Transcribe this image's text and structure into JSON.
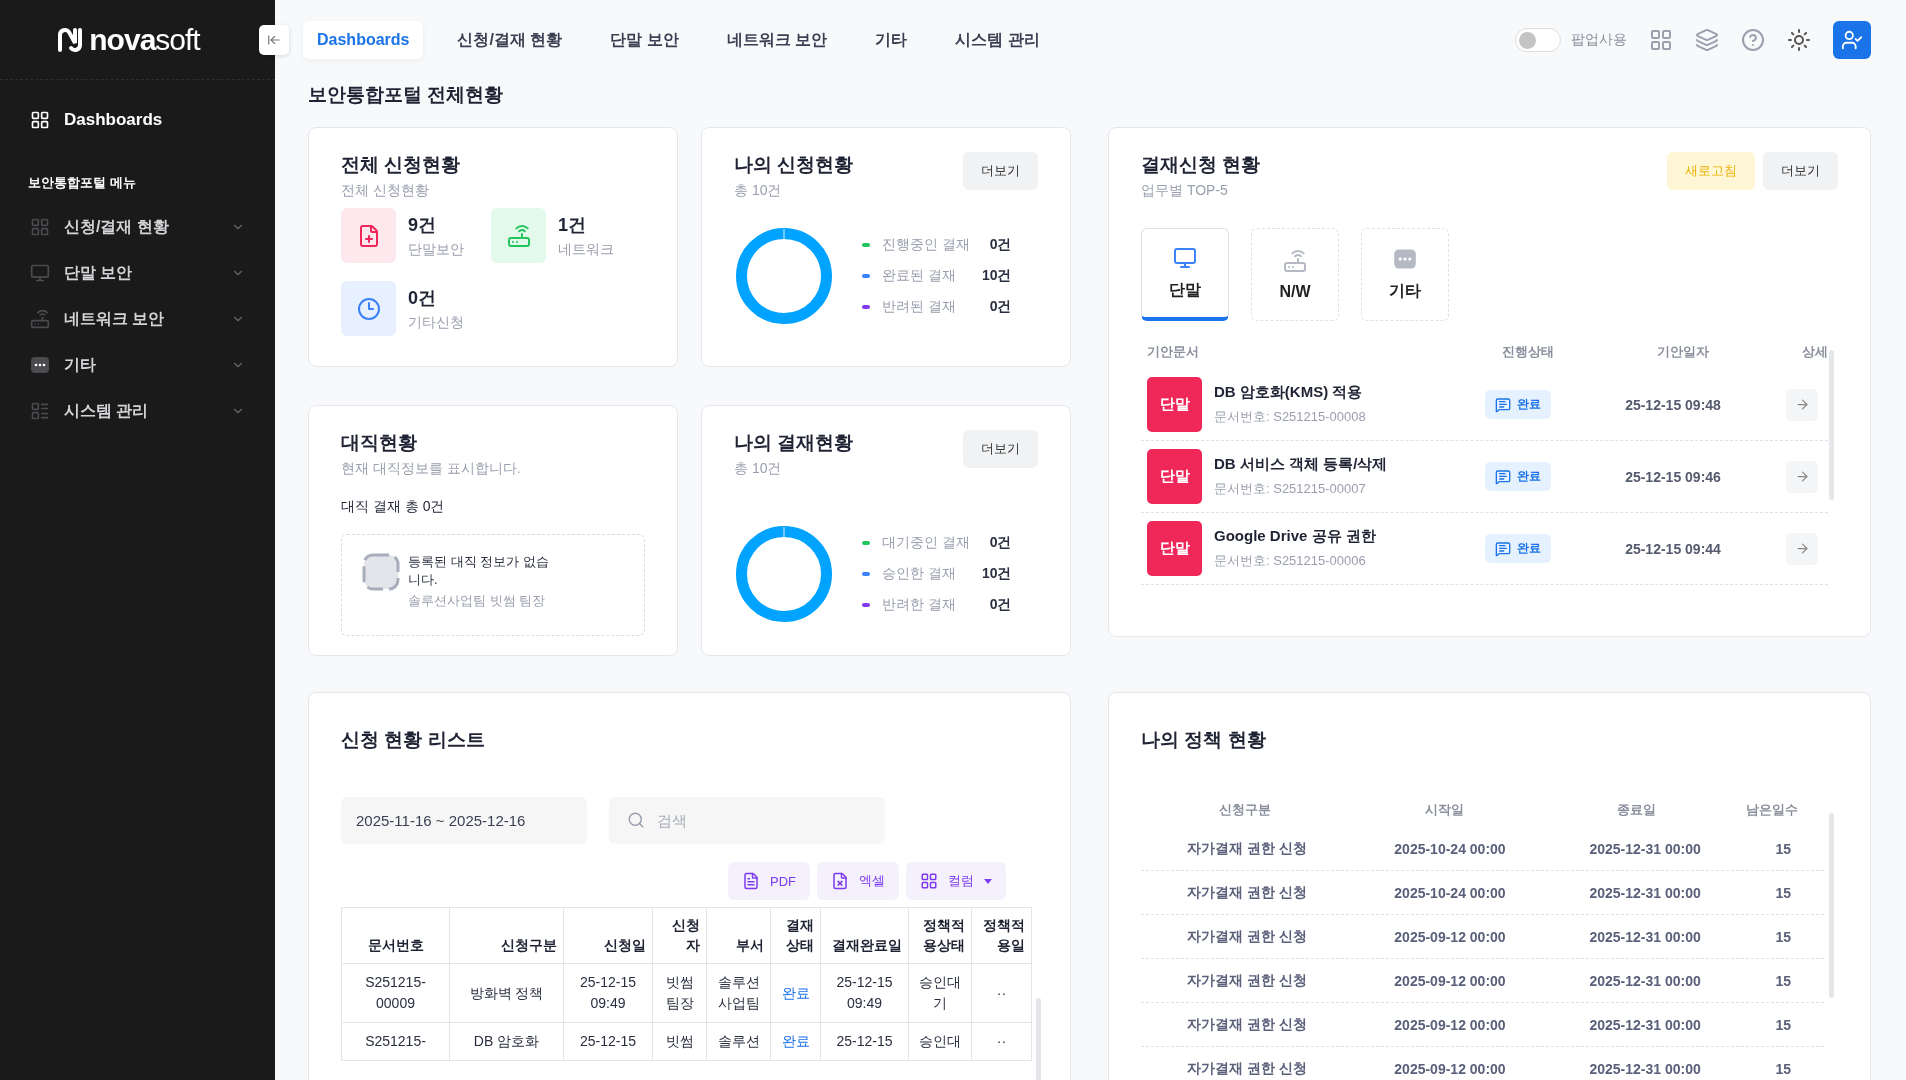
{
  "logo": {
    "strong": "nova",
    "light": "soft"
  },
  "top_nav": [
    {
      "label": "Dashboards",
      "selected": true
    },
    {
      "label": "신청/결재 현황",
      "selected": false
    },
    {
      "label": "단말 보안",
      "selected": false
    },
    {
      "label": "네트워크 보안",
      "selected": false
    },
    {
      "label": "기타",
      "selected": false
    },
    {
      "label": "시스템 관리",
      "selected": false
    }
  ],
  "popup_toggle": {
    "label": "팝업사용",
    "on": false
  },
  "sidebar": {
    "home": {
      "label": "Dashboards"
    },
    "section_title": "보안통합포털 메뉴",
    "items": [
      {
        "kind": "approval",
        "label": "신청/결재 현황"
      },
      {
        "kind": "terminal",
        "label": "단말 보안"
      },
      {
        "kind": "network",
        "label": "네트워크 보안"
      },
      {
        "kind": "other",
        "label": "기타"
      },
      {
        "kind": "system",
        "label": "시스템 관리"
      }
    ]
  },
  "page_title": "보안통합포털 전체현황",
  "total_requests": {
    "title": "전체 신청현황",
    "subtitle": "전체 신청현황",
    "stats": [
      {
        "kind": "terminal",
        "count": "9건",
        "label": "단말보안"
      },
      {
        "kind": "network",
        "count": "1건",
        "label": "네트워크"
      },
      {
        "kind": "other",
        "count": "0건",
        "label": "기타신청"
      }
    ]
  },
  "my_requests": {
    "title": "나의 신청현황",
    "subtitle": "총 10건",
    "more_button": "더보기",
    "legend": [
      {
        "label": "진행중인 결재",
        "count": "0건",
        "color": "#22c55e"
      },
      {
        "label": "완료된 결재",
        "count": "10건",
        "color": "#3b82f6"
      },
      {
        "label": "반려된 결재",
        "count": "0건",
        "color": "#7c3aed"
      }
    ]
  },
  "my_approvals": {
    "title": "나의 결재현황",
    "subtitle": "총 10건",
    "more_button": "더보기",
    "legend": [
      {
        "label": "대기중인 결재",
        "count": "0건",
        "color": "#22c55e"
      },
      {
        "label": "승인한 결재",
        "count": "10건",
        "color": "#3b82f6"
      },
      {
        "label": "반려한 결재",
        "count": "0건",
        "color": "#7c3aed"
      }
    ]
  },
  "proxy": {
    "title": "대직현황",
    "subtitle": "현재 대직정보를 표시합니다.",
    "summary": "대직 결재 총 0건",
    "empty_message": "등록된 대직 정보가 없습니다.",
    "empty_detail": "솔루션사업팀 빗썸 팀장"
  },
  "approvals": {
    "title": "결재신청 현황",
    "subtitle": "업무별 TOP-5",
    "refresh_button": "새로고침",
    "more_button": "더보기",
    "tabs": [
      {
        "kind": "terminal",
        "label": "단말",
        "selected": true
      },
      {
        "kind": "network",
        "label": "N/W",
        "selected": false
      },
      {
        "kind": "other",
        "label": "기타",
        "selected": false
      }
    ],
    "columns": [
      "기안문서",
      "진행상태",
      "기안일자",
      "상세"
    ],
    "rows": [
      {
        "tag": "단말",
        "title": "DB 암호화(KMS) 적용",
        "doc_no": "문서번호: S251215-00008",
        "status": "완료",
        "date": "25-12-15 09:48"
      },
      {
        "tag": "단말",
        "title": "DB 서비스 객체 등록/삭제",
        "doc_no": "문서번호: S251215-00007",
        "status": "완료",
        "date": "25-12-15 09:46"
      },
      {
        "tag": "단말",
        "title": "Google Drive 공유 권한",
        "doc_no": "문서번호: S251215-00006",
        "status": "완료",
        "date": "25-12-15 09:44"
      }
    ]
  },
  "request_list": {
    "title": "신청 현황 리스트",
    "date_range": "2025-11-16 ~ 2025-12-16",
    "search": {
      "placeholder": "검색"
    },
    "export_buttons": [
      {
        "kind": "pdf",
        "label": "PDF"
      },
      {
        "kind": "excel",
        "label": "엑셀"
      },
      {
        "kind": "columns",
        "label": "컬럼"
      }
    ],
    "columns": [
      "문서번호",
      "신청구분",
      "신청일",
      "신청자",
      "부서",
      "결재상태",
      "결재완료일",
      "정책적용상태",
      "정책적용일"
    ],
    "rows": [
      [
        "S251215-00009",
        "방화벽 정책",
        "25-12-15 09:49",
        "빗썸 팀장",
        "솔루션 사업팀",
        "완료",
        "25-12-15 09:49",
        "승인대기",
        "··"
      ],
      [
        "S251215-",
        "DB 암호화",
        "25-12-15",
        "빗썸",
        "솔루션",
        "완료",
        "25-12-15",
        "승인대",
        "··"
      ]
    ]
  },
  "my_policies": {
    "title": "나의 정책 현황",
    "columns": [
      "신청구분",
      "시작일",
      "종료일",
      "남은일수"
    ],
    "rows": [
      [
        "자가결재 권한 신청",
        "2025-10-24 00:00",
        "2025-12-31 00:00",
        "15"
      ],
      [
        "자가결재 권한 신청",
        "2025-10-24 00:00",
        "2025-12-31 00:00",
        "15"
      ],
      [
        "자가결재 권한 신청",
        "2025-09-12 00:00",
        "2025-12-31 00:00",
        "15"
      ],
      [
        "자가결재 권한 신청",
        "2025-09-12 00:00",
        "2025-12-31 00:00",
        "15"
      ],
      [
        "자가결재 권한 신청",
        "2025-09-12 00:00",
        "2025-12-31 00:00",
        "15"
      ],
      [
        "자가결재 권한 신청",
        "2025-09-12 00:00",
        "2025-12-31 00:00",
        "15"
      ]
    ]
  }
}
